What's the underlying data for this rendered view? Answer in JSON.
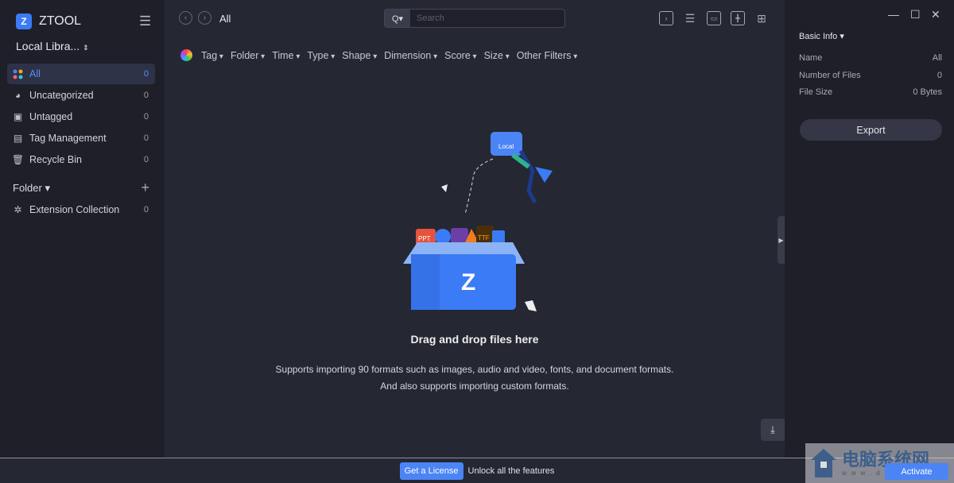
{
  "app": {
    "name": "ZTOOL",
    "library": "Local Libra..."
  },
  "sidebar": {
    "items": [
      {
        "label": "All",
        "count": "0",
        "icon": "grid-dots-icon"
      },
      {
        "label": "Uncategorized",
        "count": "0",
        "icon": "pie-icon"
      },
      {
        "label": "Untagged",
        "count": "0",
        "icon": "bookmark-icon"
      },
      {
        "label": "Tag Management",
        "count": "0",
        "icon": "tag-list-icon"
      },
      {
        "label": "Recycle Bin",
        "count": "0",
        "icon": "trash-icon"
      }
    ],
    "folder_label": "Folder ▾",
    "extension": {
      "label": "Extension Collection",
      "count": "0"
    }
  },
  "header": {
    "breadcrumb": "All",
    "search_placeholder": "Search",
    "search_btn": "Q▾"
  },
  "filters": [
    "Tag",
    "Folder",
    "Time",
    "Type",
    "Shape",
    "Dimension",
    "Score",
    "Size",
    "Other Filters"
  ],
  "empty": {
    "title": "Drag and drop files here",
    "line1": "Supports importing 90 formats such as images, audio and video, fonts, and document formats.",
    "line2": "And also supports importing custom formats.",
    "illustration_labels": [
      "Local",
      "PPT",
      "TTF"
    ]
  },
  "info": {
    "title": "Basic Info ▾",
    "rows": [
      {
        "k": "Name",
        "v": "All"
      },
      {
        "k": "Number of Files",
        "v": "0"
      },
      {
        "k": "File Size",
        "v": "0 Bytes"
      }
    ],
    "export": "Export"
  },
  "footer": {
    "license": "Get a License",
    "unlock": "Unlock all the features",
    "activate": "Activate"
  },
  "watermark": {
    "text": "电脑系统网",
    "url": "www.dnxtw.com"
  },
  "colors": {
    "accent": "#4b84f5",
    "sidebar": "#1e1f29",
    "main": "#252733"
  }
}
